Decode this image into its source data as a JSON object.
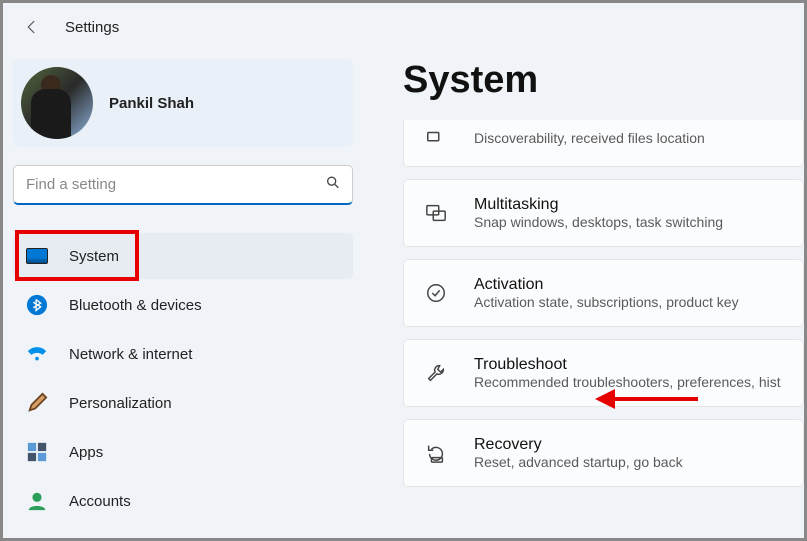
{
  "header": {
    "title": "Settings"
  },
  "profile": {
    "name": "Pankil Shah"
  },
  "search": {
    "placeholder": "Find a setting"
  },
  "sidebar": {
    "items": [
      {
        "label": "System",
        "icon": "system-icon",
        "active": true
      },
      {
        "label": "Bluetooth & devices",
        "icon": "bluetooth-icon",
        "active": false
      },
      {
        "label": "Network & internet",
        "icon": "wifi-icon",
        "active": false
      },
      {
        "label": "Personalization",
        "icon": "brush-icon",
        "active": false
      },
      {
        "label": "Apps",
        "icon": "apps-icon",
        "active": false
      },
      {
        "label": "Accounts",
        "icon": "person-icon",
        "active": false
      }
    ]
  },
  "main": {
    "title": "System",
    "cards": [
      {
        "title": "",
        "sub": "Discoverability, received files location",
        "icon": "nearby-icon",
        "partial": true
      },
      {
        "title": "Multitasking",
        "sub": "Snap windows, desktops, task switching",
        "icon": "multitask-icon"
      },
      {
        "title": "Activation",
        "sub": "Activation state, subscriptions, product key",
        "icon": "check-circle-icon"
      },
      {
        "title": "Troubleshoot",
        "sub": "Recommended troubleshooters, preferences, hist",
        "icon": "wrench-icon"
      },
      {
        "title": "Recovery",
        "sub": "Reset, advanced startup, go back",
        "icon": "recovery-icon"
      }
    ]
  },
  "annotation": {
    "highlight_target": "sidebar-item-system",
    "arrow_target": "card-troubleshoot",
    "arrow_color": "#e60000",
    "highlight_color": "#e60000"
  }
}
